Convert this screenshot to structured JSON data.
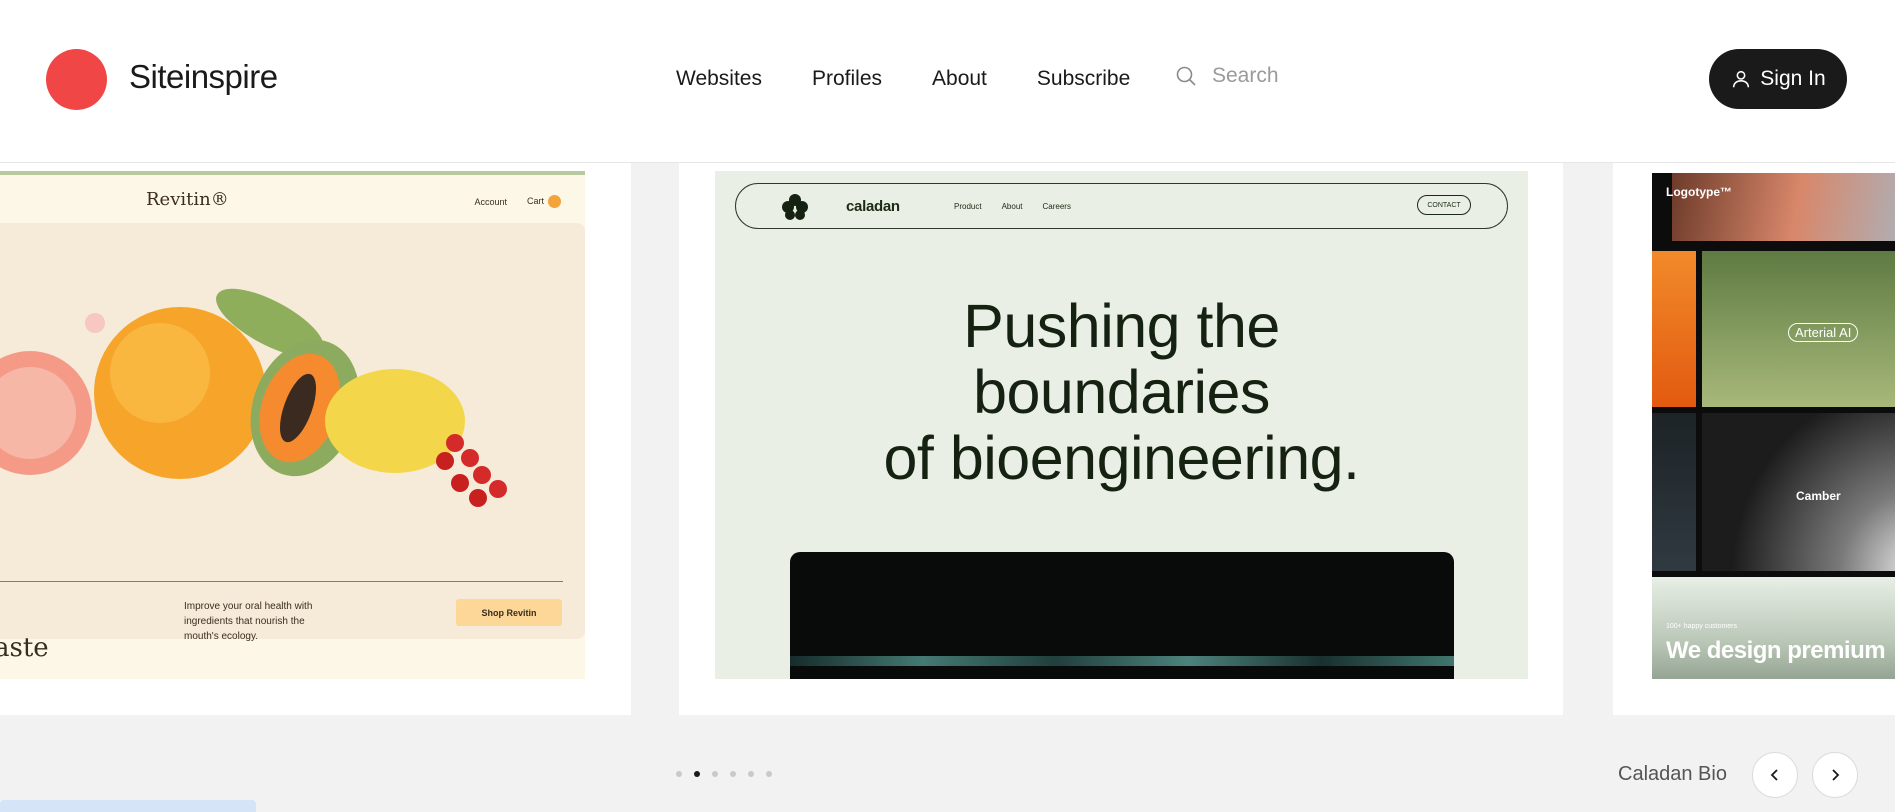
{
  "header": {
    "brand": "Siteinspire",
    "nav": [
      "Websites",
      "Profiles",
      "About",
      "Subscribe"
    ],
    "search_placeholder": "Search",
    "signin_label": "Sign In"
  },
  "cards": {
    "revitin": {
      "logo": "Revitin®",
      "nav_account": "Account",
      "nav_cart": "Cart",
      "description": "Improve your oral health with ingredients that nourish the mouth's ecology.",
      "button": "Shop Revitin",
      "partial_heading": "aste"
    },
    "caladan": {
      "brand": "caladan",
      "links": [
        "Product",
        "About",
        "Careers"
      ],
      "contact": "CONTACT",
      "headline_line1": "Pushing the",
      "headline_line2": "boundaries",
      "headline_line3": "of bioengineering."
    },
    "logotype": {
      "brand": "Logotype™",
      "arterial": "Arterial AI",
      "camber": "Camber",
      "small": "100+ happy customers",
      "big": "We design premium"
    }
  },
  "carousel": {
    "dots": 6,
    "active_dot": 2,
    "caption": "Caladan Bio"
  },
  "colors": {
    "brand_dot": "#f04646",
    "signin_bg": "#1a1a1a"
  }
}
